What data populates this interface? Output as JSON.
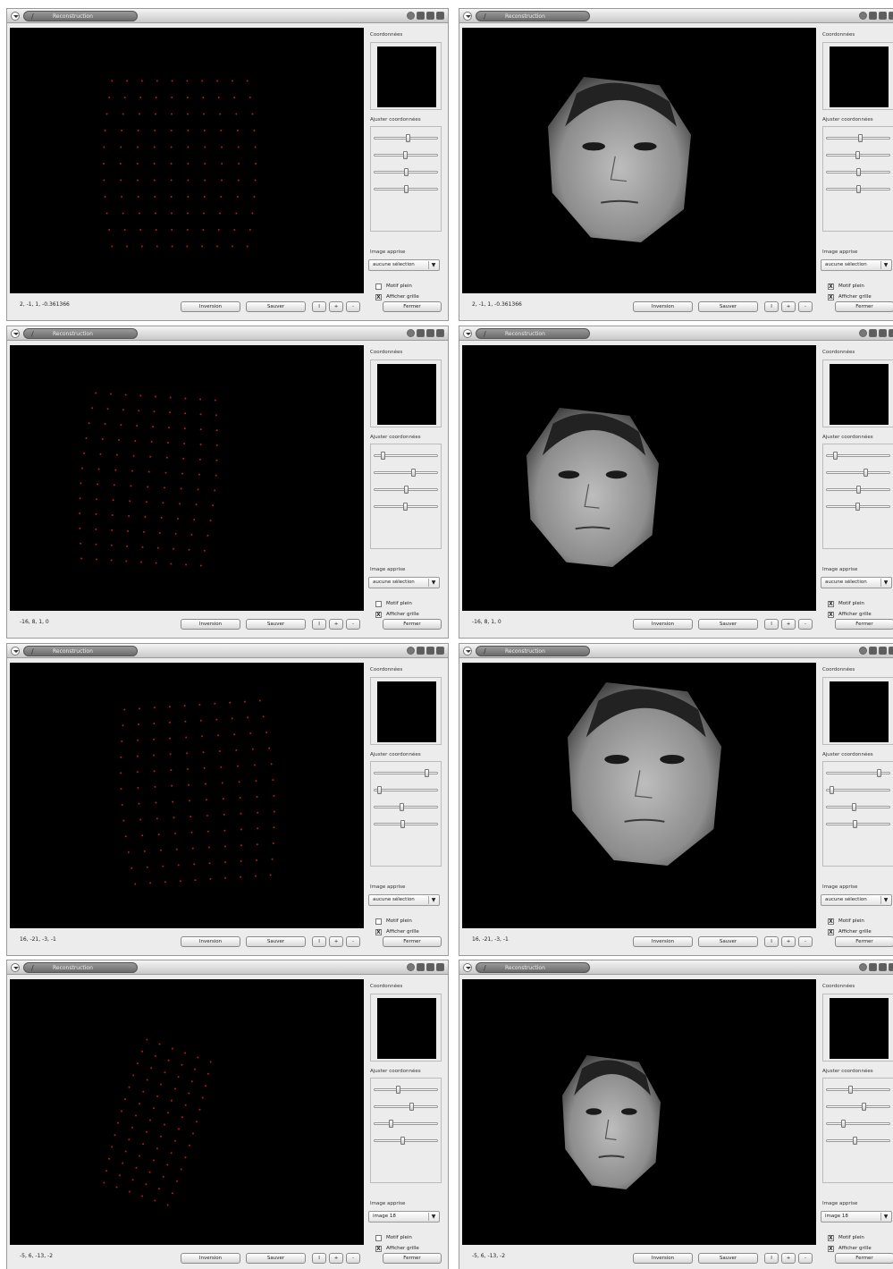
{
  "windows": [
    {
      "title": "Reconstruction",
      "coords": "2, -1, 1, -0.361366",
      "image_choice": "aucune sélection",
      "motif_plein": false,
      "afficher_grille": true,
      "view": "points",
      "sliders": [
        0.55,
        0.5,
        0.52,
        0.52
      ]
    },
    {
      "title": "Reconstruction",
      "coords": "2, -1, 1, -0.361366",
      "image_choice": "aucune sélection",
      "motif_plein": true,
      "afficher_grille": true,
      "view": "face",
      "sliders": [
        0.55,
        0.5,
        0.52,
        0.52
      ]
    },
    {
      "title": "Reconstruction",
      "coords": "-16, 8, 1, 0",
      "image_choice": "aucune sélection",
      "motif_plein": false,
      "afficher_grille": true,
      "view": "points",
      "sliders": [
        0.12,
        0.63,
        0.52,
        0.5
      ]
    },
    {
      "title": "Reconstruction",
      "coords": "-16, 8, 1, 0",
      "image_choice": "aucune sélection",
      "motif_plein": true,
      "afficher_grille": true,
      "view": "face",
      "sliders": [
        0.12,
        0.63,
        0.52,
        0.5
      ]
    },
    {
      "title": "Reconstruction",
      "coords": "16, -21, -3, -1",
      "image_choice": "aucune sélection",
      "motif_plein": false,
      "afficher_grille": true,
      "view": "points",
      "sliders": [
        0.86,
        0.06,
        0.44,
        0.46
      ]
    },
    {
      "title": "Reconstruction",
      "coords": "16, -21, -3, -1",
      "image_choice": "aucune sélection",
      "motif_plein": true,
      "afficher_grille": true,
      "view": "face",
      "sliders": [
        0.86,
        0.06,
        0.44,
        0.46
      ]
    },
    {
      "title": "Reconstruction",
      "coords": "-5, 6, -13, -2",
      "image_choice": "image 18",
      "motif_plein": false,
      "afficher_grille": true,
      "view": "points",
      "sliders": [
        0.38,
        0.6,
        0.26,
        0.46
      ]
    },
    {
      "title": "Reconstruction",
      "coords": "-5, 6, -13, -2",
      "image_choice": "image 18",
      "motif_plein": true,
      "afficher_grille": true,
      "view": "face",
      "sliders": [
        0.38,
        0.6,
        0.26,
        0.46
      ]
    }
  ],
  "labels": {
    "coordonnees": "Coordonnées",
    "ajuster": "Ajuster coordonnées",
    "image_apprise": "Image apprise",
    "motif_plein": "Motif plein",
    "afficher_grille": "Afficher grille",
    "inverser": "Inversion",
    "sauver": "Sauver",
    "btn_reset": "I",
    "btn_plus": "+",
    "btn_minus": "-",
    "fermer": "Fermer",
    "check_mark": "X"
  },
  "colors": {
    "point": "#c0181c",
    "canvas": "#000000",
    "face_skin": "#8d8d8d"
  }
}
